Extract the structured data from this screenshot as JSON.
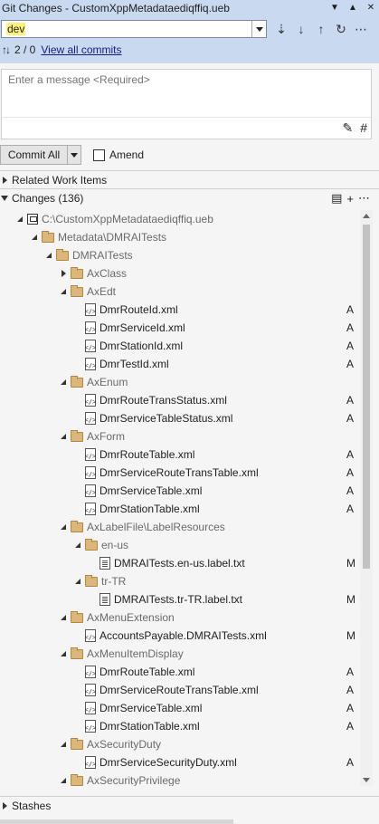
{
  "window": {
    "title": "Git Changes - CustomXppMetadataediqffiq.ueb"
  },
  "branch": {
    "name": "dev",
    "outgoing_incoming": "2 / 0",
    "view_all_commits": "View all commits"
  },
  "message": {
    "placeholder": "Enter a message <Required>"
  },
  "actions": {
    "commit_all": "Commit All",
    "amend": "Amend"
  },
  "sections": {
    "related_work_items": "Related Work Items",
    "changes": "Changes (136)",
    "stashes": "Stashes"
  },
  "tree": [
    {
      "depth": 0,
      "kind": "repo",
      "expanded": true,
      "name": "C:\\CustomXppMetadataediqffiq.ueb",
      "status": ""
    },
    {
      "depth": 1,
      "kind": "folder",
      "expanded": true,
      "name": "Metadata\\DMRAITests",
      "status": ""
    },
    {
      "depth": 2,
      "kind": "folder",
      "expanded": true,
      "name": "DMRAITests",
      "status": ""
    },
    {
      "depth": 3,
      "kind": "folder",
      "expanded": false,
      "name": "AxClass",
      "status": ""
    },
    {
      "depth": 3,
      "kind": "folder",
      "expanded": true,
      "name": "AxEdt",
      "status": ""
    },
    {
      "depth": 4,
      "kind": "xml",
      "name": "DmrRouteId.xml",
      "status": "A"
    },
    {
      "depth": 4,
      "kind": "xml",
      "name": "DmrServiceId.xml",
      "status": "A"
    },
    {
      "depth": 4,
      "kind": "xml",
      "name": "DmrStationId.xml",
      "status": "A"
    },
    {
      "depth": 4,
      "kind": "xml",
      "name": "DmrTestId.xml",
      "status": "A"
    },
    {
      "depth": 3,
      "kind": "folder",
      "expanded": true,
      "name": "AxEnum",
      "status": ""
    },
    {
      "depth": 4,
      "kind": "xml",
      "name": "DmrRouteTransStatus.xml",
      "status": "A"
    },
    {
      "depth": 4,
      "kind": "xml",
      "name": "DmrServiceTableStatus.xml",
      "status": "A"
    },
    {
      "depth": 3,
      "kind": "folder",
      "expanded": true,
      "name": "AxForm",
      "status": ""
    },
    {
      "depth": 4,
      "kind": "xml",
      "name": "DmrRouteTable.xml",
      "status": "A"
    },
    {
      "depth": 4,
      "kind": "xml",
      "name": "DmrServiceRouteTransTable.xml",
      "status": "A"
    },
    {
      "depth": 4,
      "kind": "xml",
      "name": "DmrServiceTable.xml",
      "status": "A"
    },
    {
      "depth": 4,
      "kind": "xml",
      "name": "DmrStationTable.xml",
      "status": "A"
    },
    {
      "depth": 3,
      "kind": "folder",
      "expanded": true,
      "name": "AxLabelFile\\LabelResources",
      "status": ""
    },
    {
      "depth": 4,
      "kind": "folder",
      "expanded": true,
      "name": "en-us",
      "status": ""
    },
    {
      "depth": 5,
      "kind": "txt",
      "name": "DMRAITests.en-us.label.txt",
      "status": "M"
    },
    {
      "depth": 4,
      "kind": "folder",
      "expanded": true,
      "name": "tr-TR",
      "status": ""
    },
    {
      "depth": 5,
      "kind": "txt",
      "name": "DMRAITests.tr-TR.label.txt",
      "status": "M"
    },
    {
      "depth": 3,
      "kind": "folder",
      "expanded": true,
      "name": "AxMenuExtension",
      "status": ""
    },
    {
      "depth": 4,
      "kind": "xml",
      "name": "AccountsPayable.DMRAITests.xml",
      "status": "M"
    },
    {
      "depth": 3,
      "kind": "folder",
      "expanded": true,
      "name": "AxMenuItemDisplay",
      "status": ""
    },
    {
      "depth": 4,
      "kind": "xml",
      "name": "DmrRouteTable.xml",
      "status": "A"
    },
    {
      "depth": 4,
      "kind": "xml",
      "name": "DmrServiceRouteTransTable.xml",
      "status": "A"
    },
    {
      "depth": 4,
      "kind": "xml",
      "name": "DmrServiceTable.xml",
      "status": "A"
    },
    {
      "depth": 4,
      "kind": "xml",
      "name": "DmrStationTable.xml",
      "status": "A"
    },
    {
      "depth": 3,
      "kind": "folder",
      "expanded": true,
      "name": "AxSecurityDuty",
      "status": ""
    },
    {
      "depth": 4,
      "kind": "xml",
      "name": "DmrServiceSecurityDuty.xml",
      "status": "A"
    },
    {
      "depth": 3,
      "kind": "folder",
      "expanded": true,
      "name": "AxSecurityPrivilege",
      "status": ""
    }
  ]
}
